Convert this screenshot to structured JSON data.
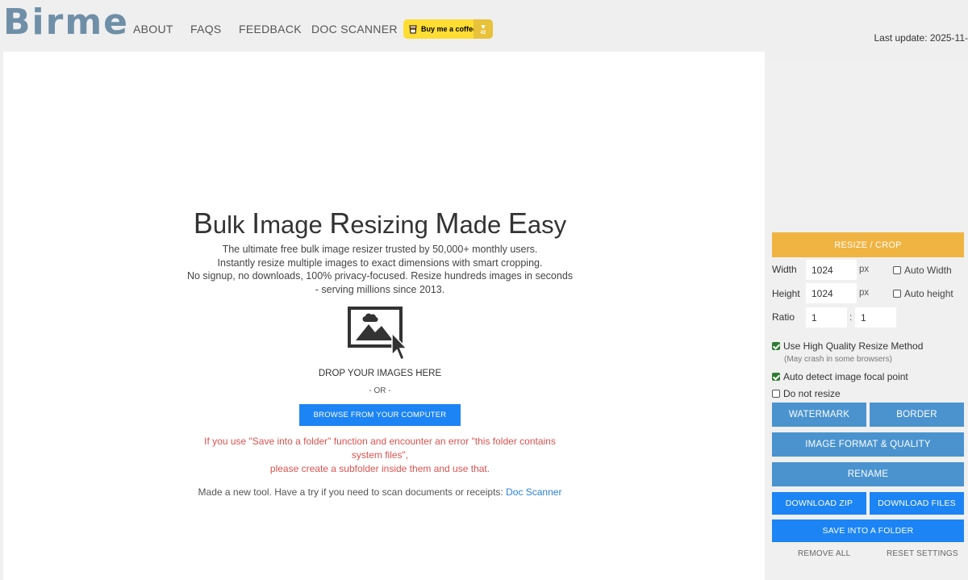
{
  "header": {
    "logo": "Birme",
    "nav": [
      "ABOUT",
      "FAQS",
      "FEEDBACK",
      "DOC SCANNER"
    ],
    "coffee_label": "Buy me a coffee",
    "coffee_count": "42",
    "last_update": "Last update: 2025-11-"
  },
  "hero": {
    "title_words": [
      {
        "cap": "B",
        "rest": "ulk "
      },
      {
        "cap": "I",
        "rest": "mage "
      },
      {
        "cap": "R",
        "rest": "esizing "
      },
      {
        "cap": "M",
        "rest": "ade "
      },
      {
        "cap": "E",
        "rest": "asy"
      }
    ],
    "subtitle_lines": [
      "The ultimate free bulk image resizer trusted by 50,000+ monthly users.",
      "Instantly resize multiple images to exact dimensions with smart cropping.",
      "No signup, no downloads, 100% privacy-focused. Resize hundreds images in seconds",
      "- serving millions since 2013."
    ],
    "drop_text": "DROP YOUR IMAGES HERE",
    "or_text": "- OR -",
    "browse_label": "BROWSE FROM YOUR COMPUTER",
    "warning_lines": [
      "If you use \"Save into a folder\" function and encounter an error \"this folder contains system files\",",
      "please create a subfolder inside them and use that."
    ],
    "new_tool_text": "Made a new tool. Have a try if you need to scan documents or receipts: ",
    "new_tool_link": "Doc Scanner"
  },
  "sidebar": {
    "resize_label": "RESIZE / CROP",
    "width_label": "Width",
    "width_value": "1024",
    "height_label": "Height",
    "height_value": "1024",
    "unit": "px",
    "auto_width": "Auto Width",
    "auto_height": "Auto height",
    "ratio_label": "Ratio",
    "ratio_a": "1",
    "ratio_sep": ":",
    "ratio_b": "1",
    "hq_label": "Use High Quality Resize Method",
    "hq_checked": true,
    "hq_note": "(May crash in some browsers)",
    "focal_label": "Auto detect image focal point",
    "focal_checked": true,
    "noresize_label": "Do not resize",
    "noresize_checked": false,
    "watermark": "WATERMARK",
    "border": "BORDER",
    "format": "IMAGE FORMAT & QUALITY",
    "rename": "RENAME",
    "download_zip": "DOWNLOAD ZIP",
    "download_files": "DOWNLOAD FILES",
    "save_folder": "SAVE INTO A FOLDER",
    "remove_all": "REMOVE ALL",
    "reset": "RESET SETTINGS"
  },
  "colors": {
    "accent_orange": "#f0b443",
    "button_blue": "#4a93cf",
    "bright_blue": "#1c84f4",
    "warning_red": "#d9534f",
    "logo": "#6f8fa8"
  },
  "icons": [
    "coffee-cup-icon",
    "image-drop-icon"
  ]
}
